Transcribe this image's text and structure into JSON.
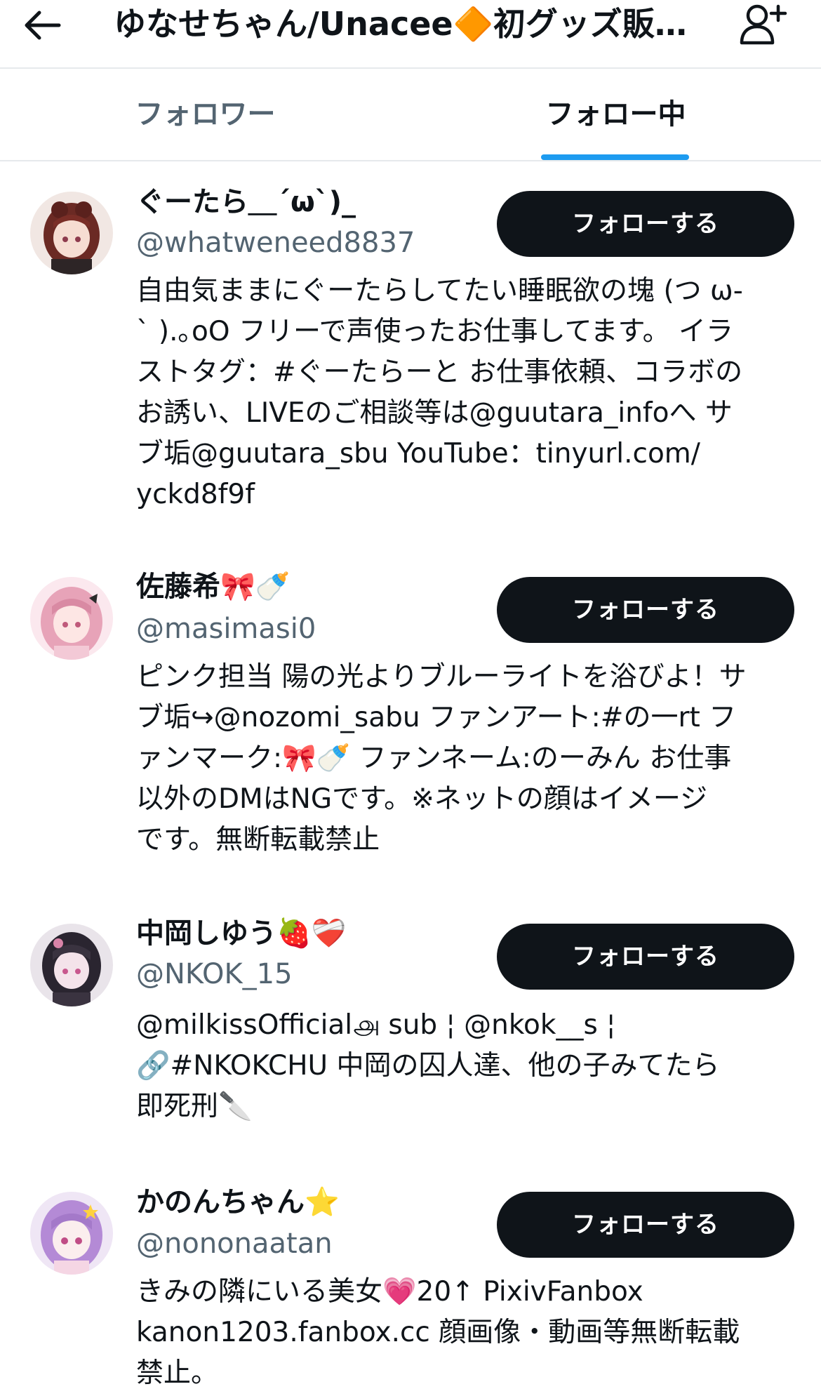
{
  "header": {
    "title": "ゆなせちゃん/Unacee🔶初グッズ販…"
  },
  "tabs": [
    {
      "label": "フォロワー"
    },
    {
      "label": "フォロー中"
    }
  ],
  "users": [
    {
      "name": "ぐーたら＿´ω`)_",
      "handle": "@whatweneed8837",
      "button": "フォローする",
      "bio": "自由気ままにぐーたらしてたい睡眠欲の塊 (つ ω-\n` ).｡oO フリーで声使ったお仕事してます。 イラ\nストタグ：#ぐーたらーと お仕事依頼、コラボの\nお誘い、LIVEのご相談等は@guutara_infoへ サ\nブ垢@guutara_sbu YouTube：tinyurl.com/\nyckd8f9f"
    },
    {
      "name": "佐藤希🎀🍼",
      "handle": "@masimasi0",
      "button": "フォローする",
      "bio": "ピンク担当 陽の光よりブルーライトを浴びよ！サ\nブ垢↪@nozomi_sabu ファンアート:#の一rt フ\nァンマーク:🎀🍼 ファンネーム:のーみん お仕事\n以外のDMはNGです。※ネットの顔はイメージ\nです。無断転載禁止"
    },
    {
      "name": "中岡しゆう🍓❤️‍🩹",
      "handle": "@NKOK_15",
      "button": "フォローする",
      "bio": "@milkissOfficial௮ sub ¦ @nkok__s ¦\n🔗#NKOKCHU 中岡の囚人達、他の子みてたら\n即死刑🔪"
    },
    {
      "name": "かのんちゃん⭐",
      "handle": "@nononaatan",
      "button": "フォローする",
      "bio": "きみの隣にいる美女💗20↑ PixivFanbox\nkanon1203.fanbox.cc 顔画像・動画等無断転載\n禁止。"
    }
  ],
  "colors": {
    "accent": "#1d9bf0",
    "button_bg": "#0f1419",
    "secondary_text": "#536471"
  }
}
